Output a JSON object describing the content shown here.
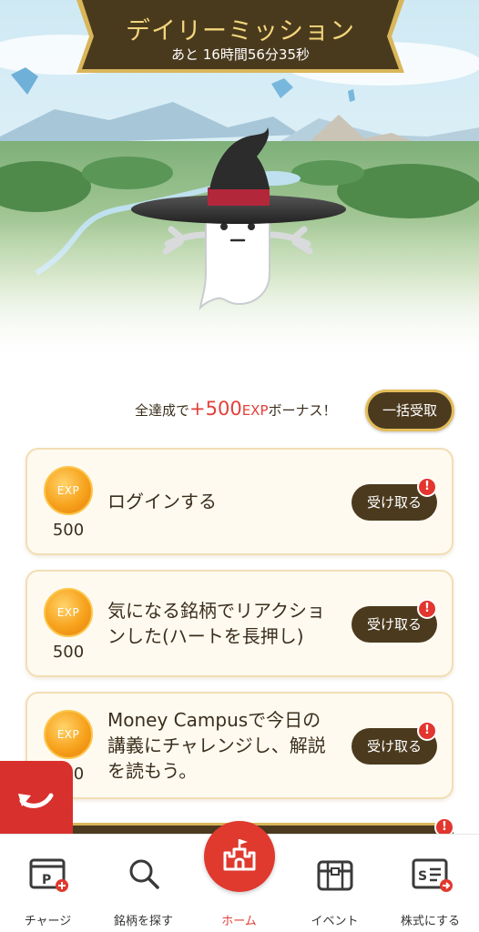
{
  "header": {
    "title": "デイリーミッション",
    "countdown": "あと 16時間56分35秒"
  },
  "bonus": {
    "prefix": "全達成で",
    "amount": "+500",
    "unit": "EXP",
    "suffix": "ボーナス！",
    "bulk_button": "一括受取"
  },
  "missions": [
    {
      "coin_label": "EXP",
      "reward": "500",
      "lines": [
        "ログインする"
      ],
      "button": "受け取る",
      "badge": "!"
    },
    {
      "coin_label": "EXP",
      "reward": "500",
      "lines": [
        "気になる銘柄でリアクショ",
        "ンした(ハートを長押し)"
      ],
      "button": "受け取る",
      "badge": "!"
    },
    {
      "coin_label": "EXP",
      "reward": "500",
      "lines": [
        "Money Campusで今日の",
        "講義にチャレンジし、解説",
        "を読もう。"
      ],
      "button": "受け取る",
      "badge": "!"
    }
  ],
  "partial_badge": "!",
  "nav": {
    "items": [
      {
        "label": "チャージ",
        "icon": "charge-card-icon"
      },
      {
        "label": "銘柄を探す",
        "icon": "search-icon"
      },
      {
        "label": "ホーム",
        "icon": "castle-home-icon"
      },
      {
        "label": "イベント",
        "icon": "treasure-chest-icon"
      },
      {
        "label": "株式にする",
        "icon": "stock-convert-icon"
      }
    ],
    "active": "ホーム"
  },
  "colors": {
    "brand_red": "#e0392e",
    "dark_brown": "#4b3a1e",
    "gold": "#e3bd5a",
    "card_bg": "#fffaf0"
  }
}
